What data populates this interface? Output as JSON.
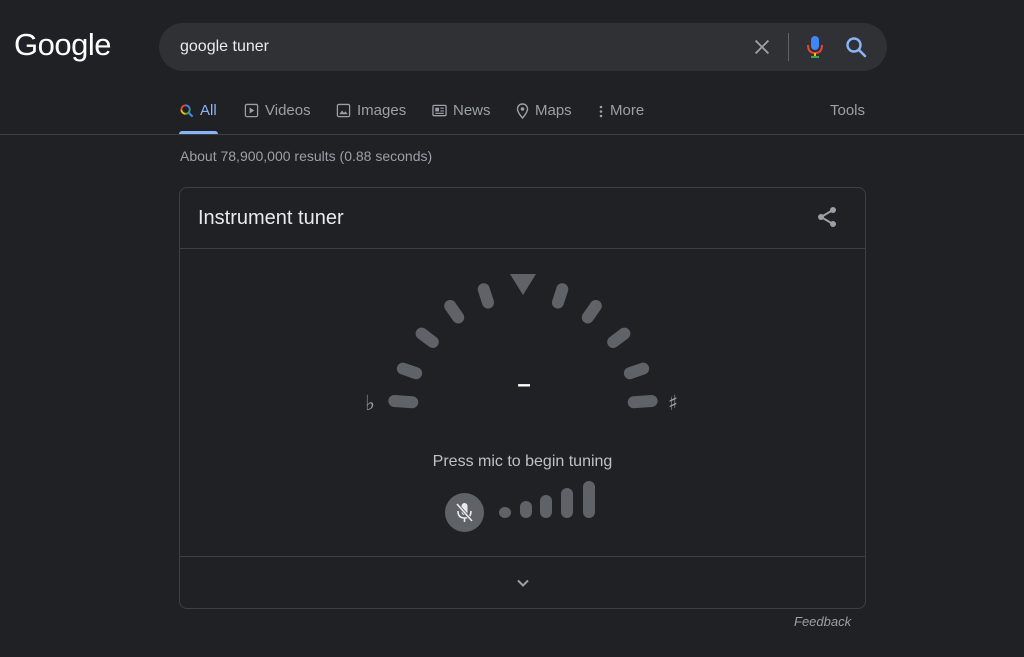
{
  "logo": {
    "text": "Google"
  },
  "search": {
    "value": "google tuner"
  },
  "icons": {
    "clear": "close-icon",
    "mic": "mic-icon",
    "search": "search-icon"
  },
  "tabs": [
    {
      "label": "All",
      "icon": "search-icon",
      "active": true
    },
    {
      "label": "Videos",
      "icon": "play-icon",
      "active": false
    },
    {
      "label": "Images",
      "icon": "image-icon",
      "active": false
    },
    {
      "label": "News",
      "icon": "news-icon",
      "active": false
    },
    {
      "label": "Maps",
      "icon": "map-pin-icon",
      "active": false
    },
    {
      "label": "More",
      "icon": "more-vert-icon",
      "active": false
    }
  ],
  "tools_label": "Tools",
  "result_stats": "About 78,900,000 results (0.88 seconds)",
  "tuner": {
    "title": "Instrument tuner",
    "flat_symbol": "♭",
    "sharp_symbol": "♯",
    "note": "–",
    "prompt": "Press mic to begin tuning",
    "mic_muted": true,
    "signal_level": 0
  },
  "feedback_label": "Feedback",
  "colors": {
    "background": "#202124",
    "surface": "#303134",
    "accent": "#8ab4f8",
    "dial_segment": "#5f6368",
    "text_secondary": "#9aa0a6"
  }
}
